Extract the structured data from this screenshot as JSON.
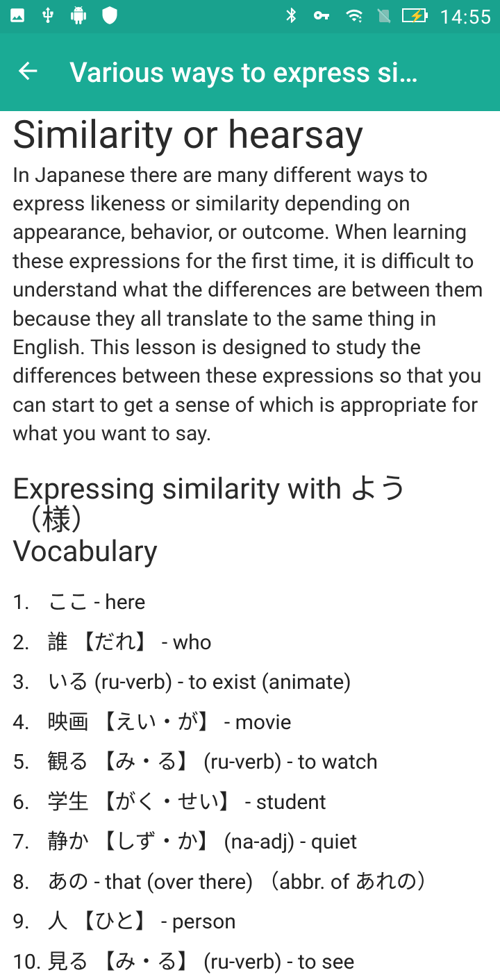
{
  "statusBar": {
    "time": "14:55"
  },
  "appBar": {
    "title": "Various ways to express si…"
  },
  "page": {
    "heading": "Similarity or hearsay",
    "intro": "In Japanese there are many different ways to express likeness or similarity depending on appearance, behavior, or outcome. When learning these expressions for the first time, it is difficult to understand what the differences are between them because they all translate to the same thing in English. This lesson is designed to study the differences between these expressions so that you can start to get a sense of which is appropriate for what you want to say.",
    "subheading": "Expressing similarity with よう （様）",
    "vocabHeading": "Vocabulary",
    "vocab": [
      {
        "n": "1.",
        "text": "ここ - here"
      },
      {
        "n": "2.",
        "text": "誰 【だれ】 - who"
      },
      {
        "n": "3.",
        "text": "いる (ru-verb) - to exist (animate)"
      },
      {
        "n": "4.",
        "text": "映画 【えい・が】 - movie"
      },
      {
        "n": "5.",
        "text": "観る 【み・る】 (ru-verb) - to watch"
      },
      {
        "n": "6.",
        "text": "学生 【がく・せい】 - student"
      },
      {
        "n": "7.",
        "text": "静か 【しず・か】 (na-adj) - quiet"
      },
      {
        "n": "8.",
        "text": "あの - that (over there) （abbr. of あれの）"
      },
      {
        "n": "9.",
        "text": "人 【ひと】 - person"
      },
      {
        "n": "10.",
        "text": "見る 【み・る】 (ru-verb) - to see"
      }
    ]
  }
}
